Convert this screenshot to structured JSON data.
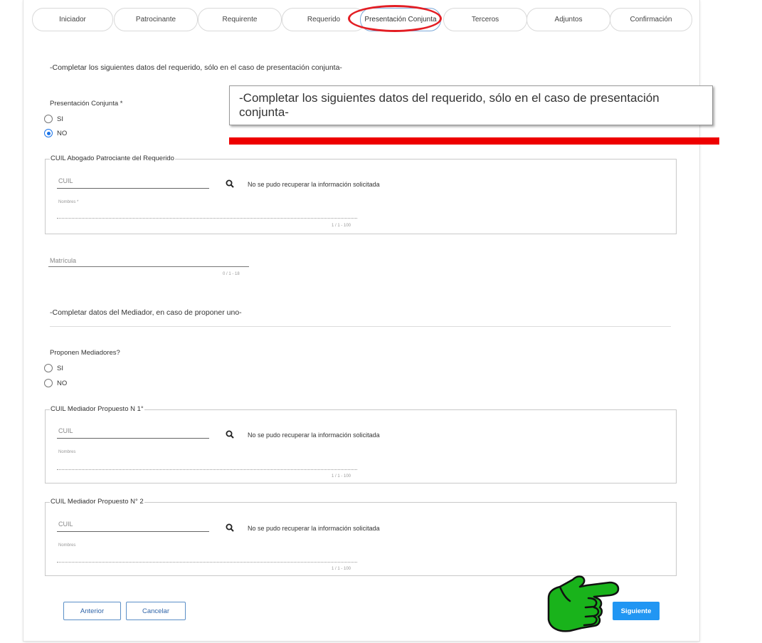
{
  "tabs": [
    {
      "label": "Iniciador"
    },
    {
      "label": "Patrocinante"
    },
    {
      "label": "Requirente"
    },
    {
      "label": "Requerido"
    },
    {
      "label": "Presentación Conjunta"
    },
    {
      "label": "Terceros"
    },
    {
      "label": "Adjuntos"
    },
    {
      "label": "Confirmación"
    }
  ],
  "intro_text": "-Completar los siguientes datos del requerido, sólo en el caso de presentación conjunta-",
  "callout_text": "-Completar los siguientes datos del requerido, sólo en el caso de presentación conjunta-",
  "presentacion": {
    "label": "Presentación Conjunta *",
    "options": [
      "SI",
      "NO"
    ],
    "selected": "NO"
  },
  "abogado": {
    "legend": "CUIL Abogado Patrociante del Requerido",
    "cuil_placeholder": "CUIL",
    "message": "No se pudo recuperar la información solicitada",
    "nombres_label": "Nombres *",
    "counter": "1 / 1 - 100"
  },
  "matricula": {
    "placeholder": "Matrícula",
    "counter": "0 / 1 - 18"
  },
  "mediador_text": "-Completar datos del Mediador, en caso de proponer uno-",
  "proponen": {
    "label": "Proponen Mediadores?",
    "options": [
      "SI",
      "NO"
    ]
  },
  "mediador1": {
    "legend": "CUIL Mediador Propuesto N 1°",
    "cuil_placeholder": "CUIL",
    "message": "No se pudo recuperar la información solicitada",
    "nombres_label": "Nombres",
    "counter": "1 / 1 - 100"
  },
  "mediador2": {
    "legend": "CUIL Mediador Propuesto N° 2",
    "cuil_placeholder": "CUIL",
    "message": "No se pudo recuperar la información solicitada",
    "nombres_label": "Nombres",
    "counter": "1 / 1 - 100"
  },
  "buttons": {
    "anterior": "Anterior",
    "cancelar": "Cancelar",
    "siguiente": "Siguiente"
  },
  "colors": {
    "accent": "#2196f3",
    "highlight_red": "#e31e24",
    "pointer_green": "#19b31b"
  },
  "icons": [
    "search-icon",
    "pointing-hand-icon"
  ]
}
